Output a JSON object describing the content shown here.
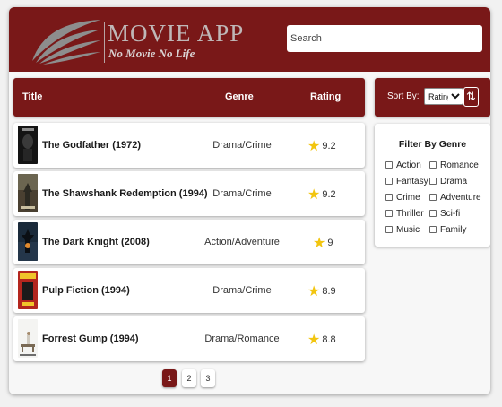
{
  "header": {
    "app_name": "MOVIE APP",
    "slogan": "No Movie No Life",
    "search_placeholder": "Search",
    "search_value": ""
  },
  "table": {
    "columns": {
      "title": "Title",
      "genre": "Genre",
      "rating": "Rating"
    },
    "rows": [
      {
        "title": "The Godfather (1972)",
        "genre": "Drama/Crime",
        "rating": "9.2",
        "poster": "poster-godfather"
      },
      {
        "title": "The Shawshank Redemption (1994)",
        "genre": "Drama/Crime",
        "rating": "9.2",
        "poster": "poster-shawshank"
      },
      {
        "title": "The Dark Knight (2008)",
        "genre": "Action/Adventure",
        "rating": "9",
        "poster": "poster-dark-knight"
      },
      {
        "title": "Pulp Fiction (1994)",
        "genre": "Drama/Crime",
        "rating": "8.9",
        "poster": "poster-pulp-fiction"
      },
      {
        "title": "Forrest Gump (1994)",
        "genre": "Drama/Romance",
        "rating": "8.8",
        "poster": "poster-forrest-gump"
      }
    ]
  },
  "pagination": {
    "pages": [
      "1",
      "2",
      "3"
    ],
    "active": "1"
  },
  "sort": {
    "label": "Sort By:",
    "selected": "Rating",
    "order_icon": "sort-order-icon"
  },
  "filter": {
    "title": "Filter By Genre",
    "options": [
      "Action",
      "Romance",
      "Fantasy",
      "Drama",
      "Crime",
      "Adventure",
      "Thriller",
      "Sci-fi",
      "Music",
      "Family"
    ]
  },
  "colors": {
    "brand": "#791818",
    "star": "#f2c50f",
    "background": "#f1f1f1"
  }
}
